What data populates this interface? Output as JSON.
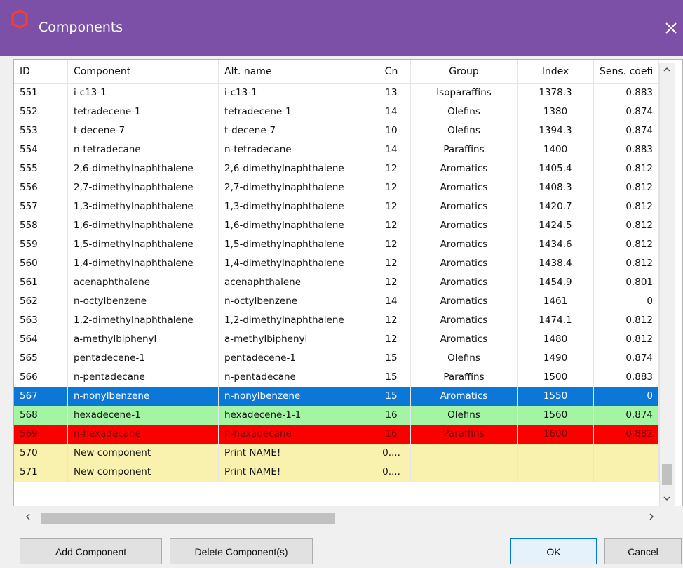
{
  "window": {
    "title": "Components",
    "close_icon": "close-icon",
    "app_icon": "hexagon-icon",
    "colors": {
      "titlebar": "#7b50a6",
      "selected": "#0b78d7",
      "green": "#a3f4a3",
      "red": "#fb0000",
      "yellow": "#f8f2ae"
    }
  },
  "table": {
    "columns": [
      "ID",
      "Component",
      "Alt. name",
      "Cn",
      "Group",
      "Index",
      "Sens. coefi"
    ],
    "rows": [
      [
        "551",
        "i-c13-1",
        "i-c13-1",
        "13",
        "Isoparaffins",
        "1378.3",
        "0.883"
      ],
      [
        "552",
        "tetradecene-1",
        "tetradecene-1",
        "14",
        "Olefins",
        "1380",
        "0.874"
      ],
      [
        "553",
        "t-decene-7",
        "t-decene-7",
        "10",
        "Olefins",
        "1394.3",
        "0.874"
      ],
      [
        "554",
        "n-tetradecane",
        "n-tetradecane",
        "14",
        "Paraffins",
        "1400",
        "0.883"
      ],
      [
        "555",
        "2,6-dimethylnaphthalene",
        "2,6-dimethylnaphthalene",
        "12",
        "Aromatics",
        "1405.4",
        "0.812"
      ],
      [
        "556",
        "2,7-dimethylnaphthalene",
        "2,7-dimethylnaphthalene",
        "12",
        "Aromatics",
        "1408.3",
        "0.812"
      ],
      [
        "557",
        "1,3-dimethylnaphthalene",
        "1,3-dimethylnaphthalene",
        "12",
        "Aromatics",
        "1420.7",
        "0.812"
      ],
      [
        "558",
        "1,6-dimethylnaphthalene",
        "1,6-dimethylnaphthalene",
        "12",
        "Aromatics",
        "1424.5",
        "0.812"
      ],
      [
        "559",
        "1,5-dimethylnaphthalene",
        "1,5-dimethylnaphthalene",
        "12",
        "Aromatics",
        "1434.6",
        "0.812"
      ],
      [
        "560",
        "1,4-dimethylnaphthalene",
        "1,4-dimethylnaphthalene",
        "12",
        "Aromatics",
        "1438.4",
        "0.812"
      ],
      [
        "561",
        "acenaphthalene",
        "acenaphthalene",
        "12",
        "Aromatics",
        "1454.9",
        "0.801"
      ],
      [
        "562",
        "n-octylbenzene",
        "n-octylbenzene",
        "14",
        "Aromatics",
        "1461",
        "0"
      ],
      [
        "563",
        "1,2-dimethylnaphthalene",
        "1,2-dimethylnaphthalene",
        "12",
        "Aromatics",
        "1474.1",
        "0.812"
      ],
      [
        "564",
        "a-methylbiphenyl",
        "a-methylbiphenyl",
        "12",
        "Aromatics",
        "1480",
        "0.812"
      ],
      [
        "565",
        "pentadecene-1",
        "pentadecene-1",
        "15",
        "Olefins",
        "1490",
        "0.874"
      ],
      [
        "566",
        "n-pentadecane",
        "n-pentadecane",
        "15",
        "Paraffins",
        "1500",
        "0.883"
      ],
      [
        "567",
        "n-nonylbenzene",
        "n-nonylbenzene",
        "15",
        "Aromatics",
        "1550",
        "0"
      ],
      [
        "568",
        "hexadecene-1",
        "hexadecene-1-1",
        "16",
        "Olefins",
        "1560",
        "0.874"
      ],
      [
        "569",
        "n-hexadecane",
        "n-hexadecane",
        "16",
        "Paraffins",
        "1600",
        "0.882"
      ],
      [
        "570",
        "New component",
        "Print NAME!",
        "0....",
        "",
        "",
        ""
      ],
      [
        "571",
        "New component",
        "Print NAME!",
        "0....",
        "",
        "",
        ""
      ]
    ],
    "row_styles": {
      "567": "blue",
      "568": "green",
      "569": "red",
      "570": "yellow",
      "571": "yellow"
    },
    "scroll_icons": {
      "up": "chevron-up-icon",
      "down": "chevron-down-icon",
      "left": "chevron-left-icon",
      "right": "chevron-right-icon"
    }
  },
  "buttons": {
    "add": "Add Component",
    "delete": "Delete Component(s)",
    "ok": "OK",
    "cancel": "Cancel"
  }
}
